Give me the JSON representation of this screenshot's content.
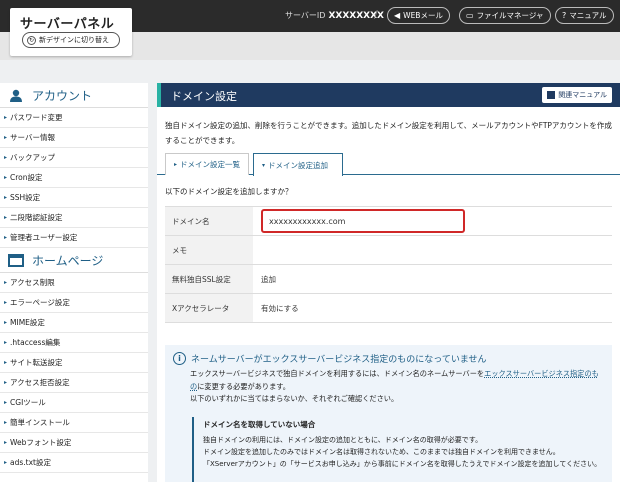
{
  "header": {
    "app_title": "サーバーパネル",
    "switch_label": "新デザインに切り替え",
    "server_id_label": "サーバーID",
    "server_id_value": "XXXXXXXX",
    "separator": "/",
    "webmail_label": "WEBメール",
    "filemanager_label": "ファイルマネージャ",
    "manual_label": "マニュアル"
  },
  "sidebar": {
    "account_heading": "アカウント",
    "account_items": [
      "パスワード変更",
      "サーバー情報",
      "バックアップ",
      "Cron設定",
      "SSH設定",
      "二段階認証設定",
      "管理者ユーザー設定"
    ],
    "homepage_heading": "ホームページ",
    "homepage_items": [
      "アクセス制限",
      "エラーページ設定",
      "MIME設定",
      ".htaccess編集",
      "サイト転送設定",
      "アクセス拒否設定",
      "CGIツール",
      "簡単インストール",
      "Webフォント設定",
      "ads.txt設定"
    ]
  },
  "main": {
    "title": "ドメイン設定",
    "manual_button": "関連マニュアル",
    "description": "独自ドメイン設定の追加、削除を行うことができます。追加したドメイン設定を利用して、メールアカウントやFTPアカウントを作成することができます。",
    "tabs": [
      {
        "label": "ドメイン設定一覧",
        "active": false
      },
      {
        "label": "ドメイン設定追加",
        "active": true
      }
    ],
    "question": "以下のドメイン設定を追加しますか？",
    "rows": [
      {
        "label": "ドメイン名",
        "value": "xxxxxxxxxxxx.com"
      },
      {
        "label": "メモ",
        "value": ""
      },
      {
        "label": "無料独自SSL設定",
        "value": "追加"
      },
      {
        "label": "Xアクセラレータ",
        "value": "有効にする"
      }
    ],
    "notice": {
      "title": "ネームサーバーがエックスサーバービジネス指定のものになっていません",
      "body_1": "エックスサーバービジネスで独自ドメインを利用するには、ドメイン名のネームサーバーを",
      "body_link": "エックスサーバービジネス指定のもの",
      "body_2": "に変更する必要があります。",
      "body_3": "以下のいずれかに当てはまらないか、それぞれご確認ください。",
      "sub_title": "ドメイン名を取得していない場合",
      "sub_line_1": "独自ドメインの利用には、ドメイン設定の追加とともに、ドメイン名の取得が必要です。",
      "sub_line_2": "ドメイン設定を追加したのみではドメイン名は取得されないため、このままでは独自ドメインを利用できません。",
      "sub_line_3": "「XServerアカウント」の「サービスお申し込み」から事前にドメイン名を取得したうえでドメイン設定を追加してください。"
    }
  }
}
